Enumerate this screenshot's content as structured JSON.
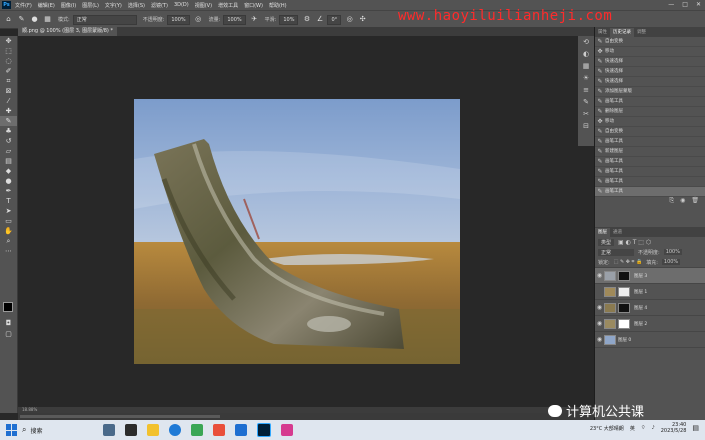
{
  "menubar": {
    "logo": "Ps",
    "items": [
      "文件(F)",
      "编辑(E)",
      "图像(I)",
      "图层(L)",
      "文字(Y)",
      "选择(S)",
      "滤镜(T)",
      "3D(D)",
      "视图(V)",
      "增效工具",
      "窗口(W)",
      "帮助(H)"
    ],
    "window_controls": [
      "—",
      "□",
      "✕"
    ]
  },
  "options": {
    "mode_label": "模式:",
    "mode_value": "正常",
    "opacity_label": "不透明度:",
    "opacity_value": "100%",
    "flow_label": "流量:",
    "flow_value": "100%",
    "smooth_label": "平滑:",
    "smooth_value": "10%",
    "angle_value": "0°"
  },
  "watermark": "www.haoyiluilianheji.com",
  "document_tab": "顺.png @ 100% (图层 3, 图层蒙版/8) *",
  "status": "18.88%",
  "panel": {
    "tabs": [
      "属性",
      "历史记录",
      "调整"
    ],
    "history": [
      {
        "label": "自由变换",
        "icon": "✎"
      },
      {
        "label": "移动",
        "icon": "✥"
      },
      {
        "label": "快速选择",
        "icon": "✎"
      },
      {
        "label": "快速选择",
        "icon": "✎"
      },
      {
        "label": "快速选择",
        "icon": "✎"
      },
      {
        "label": "添加图层蒙版",
        "icon": "✎"
      },
      {
        "label": "画笔工具",
        "icon": "✎"
      },
      {
        "label": "删除图层",
        "icon": "✎"
      },
      {
        "label": "移动",
        "icon": "✥"
      },
      {
        "label": "自由变换",
        "icon": "✎"
      },
      {
        "label": "画笔工具",
        "icon": "✎"
      },
      {
        "label": "新建图层",
        "icon": "✎"
      },
      {
        "label": "画笔工具",
        "icon": "✎"
      },
      {
        "label": "画笔工具",
        "icon": "✎"
      },
      {
        "label": "画笔工具",
        "icon": "✎"
      },
      {
        "label": "画笔工具",
        "icon": "✎"
      }
    ],
    "layer_tabs": [
      "图层",
      "通道"
    ],
    "layer_kind": "类型",
    "blend_mode": "正常",
    "opacity_label": "不透明度:",
    "opacity_value": "100%",
    "lock_label": "锁定:",
    "fill_label": "填充:",
    "fill_value": "100%",
    "layers": [
      {
        "name": "图层 3",
        "visible": true
      },
      {
        "name": "图层 1",
        "visible": false
      },
      {
        "name": "图层 4",
        "visible": true
      },
      {
        "name": "图层 2",
        "visible": true
      },
      {
        "name": "图层 0",
        "visible": true
      }
    ]
  },
  "taskbar": {
    "search": "搜索",
    "weather": "23°C 大部晴朗",
    "lang": "英",
    "time": "23:40",
    "date": "2023/5/28"
  },
  "brand_watermark": "计算机公共课",
  "colors": {
    "accent": "#31a8ff",
    "watermark": "#ff2b2b",
    "panel_bg": "#535353",
    "canvas_bg": "#282828"
  }
}
